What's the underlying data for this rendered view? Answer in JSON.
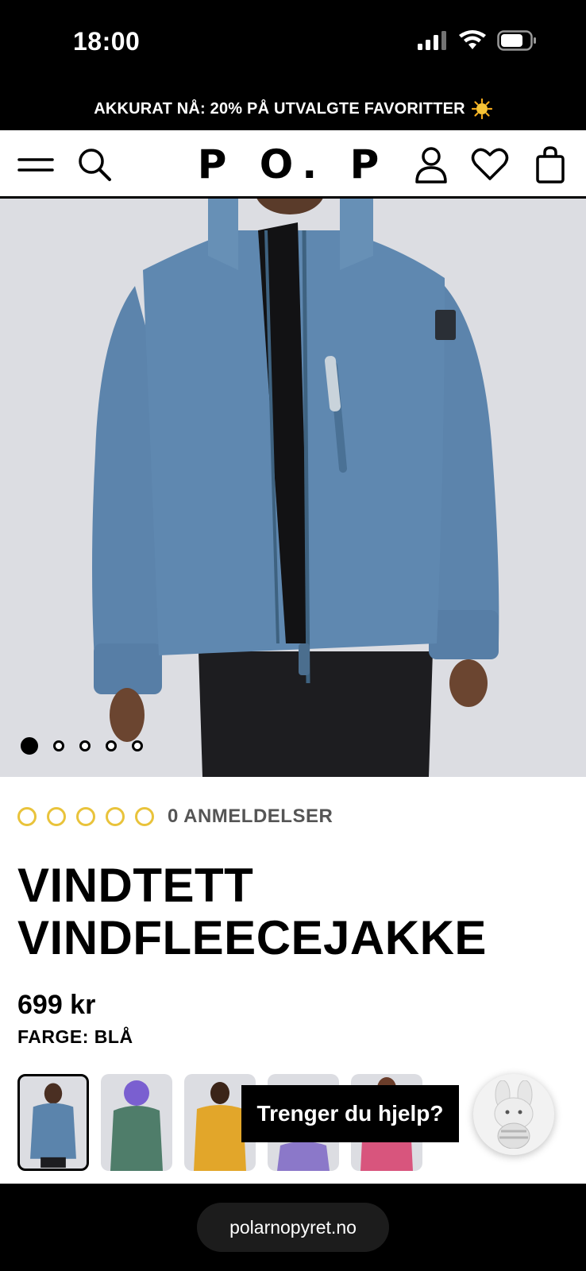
{
  "status": {
    "time": "18:00"
  },
  "promo": {
    "text": "AKKURAT NÅ: 20% PÅ UTVALGTE FAVORITTER"
  },
  "header": {
    "logo": "P O. P",
    "icons": [
      "menu-icon",
      "search-icon",
      "account-icon",
      "heart-icon",
      "bag-icon"
    ]
  },
  "gallery": {
    "image_count": 5,
    "active_index": 0
  },
  "product": {
    "rating_stars": 0,
    "reviews_label": "0 ANMELDELSER",
    "title_line1": "VINDTETT",
    "title_line2": "VINDFLEECEJAKKE",
    "price": "699 kr",
    "color_label": "FARGE: BLÅ"
  },
  "swatches": [
    {
      "name": "blå",
      "color": "#5b84ac",
      "selected": true
    },
    {
      "name": "grønn",
      "color": "#4f7d6a",
      "selected": false
    },
    {
      "name": "gul",
      "color": "#e2a62a",
      "selected": false
    },
    {
      "name": "lilla",
      "color": "#8b78c9",
      "selected": false
    },
    {
      "name": "rosa",
      "color": "#d8557d",
      "selected": false
    }
  ],
  "help": {
    "label": "Trenger du hjelp?"
  },
  "browser": {
    "url": "polarnopyret.no"
  },
  "colors": {
    "accent_star": "#e9c33b",
    "jacket": "#5b84ac"
  }
}
